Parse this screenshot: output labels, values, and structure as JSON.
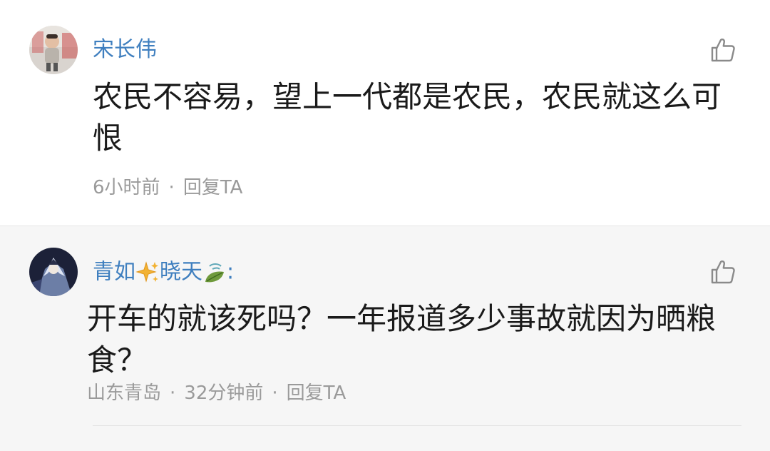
{
  "comments": [
    {
      "username": "宋长伟",
      "content": "农民不容易，望上一代都是农民，农民就这么可恨",
      "time": "6小时前",
      "separator": "·",
      "reply_label": "回复TA"
    },
    {
      "username_part1": "青如",
      "username_part2": "晓天",
      "username_suffix": ":",
      "content": "开车的就该死吗？一年报道多少事故就因为晒粮食？",
      "location": "山东青岛",
      "time": "32分钟前",
      "separator": "·",
      "reply_label": "回复TA"
    }
  ],
  "colors": {
    "username": "#3f7fbf",
    "content": "#1a1a1a",
    "meta": "#9a9a9a",
    "highlight_background": "#f6f6f6"
  },
  "icons": {
    "like": "thumbs-up-icon",
    "sparkle_emoji": "sparkles-emoji-icon",
    "tea_emoji": "leaf-tea-emoji-icon"
  }
}
